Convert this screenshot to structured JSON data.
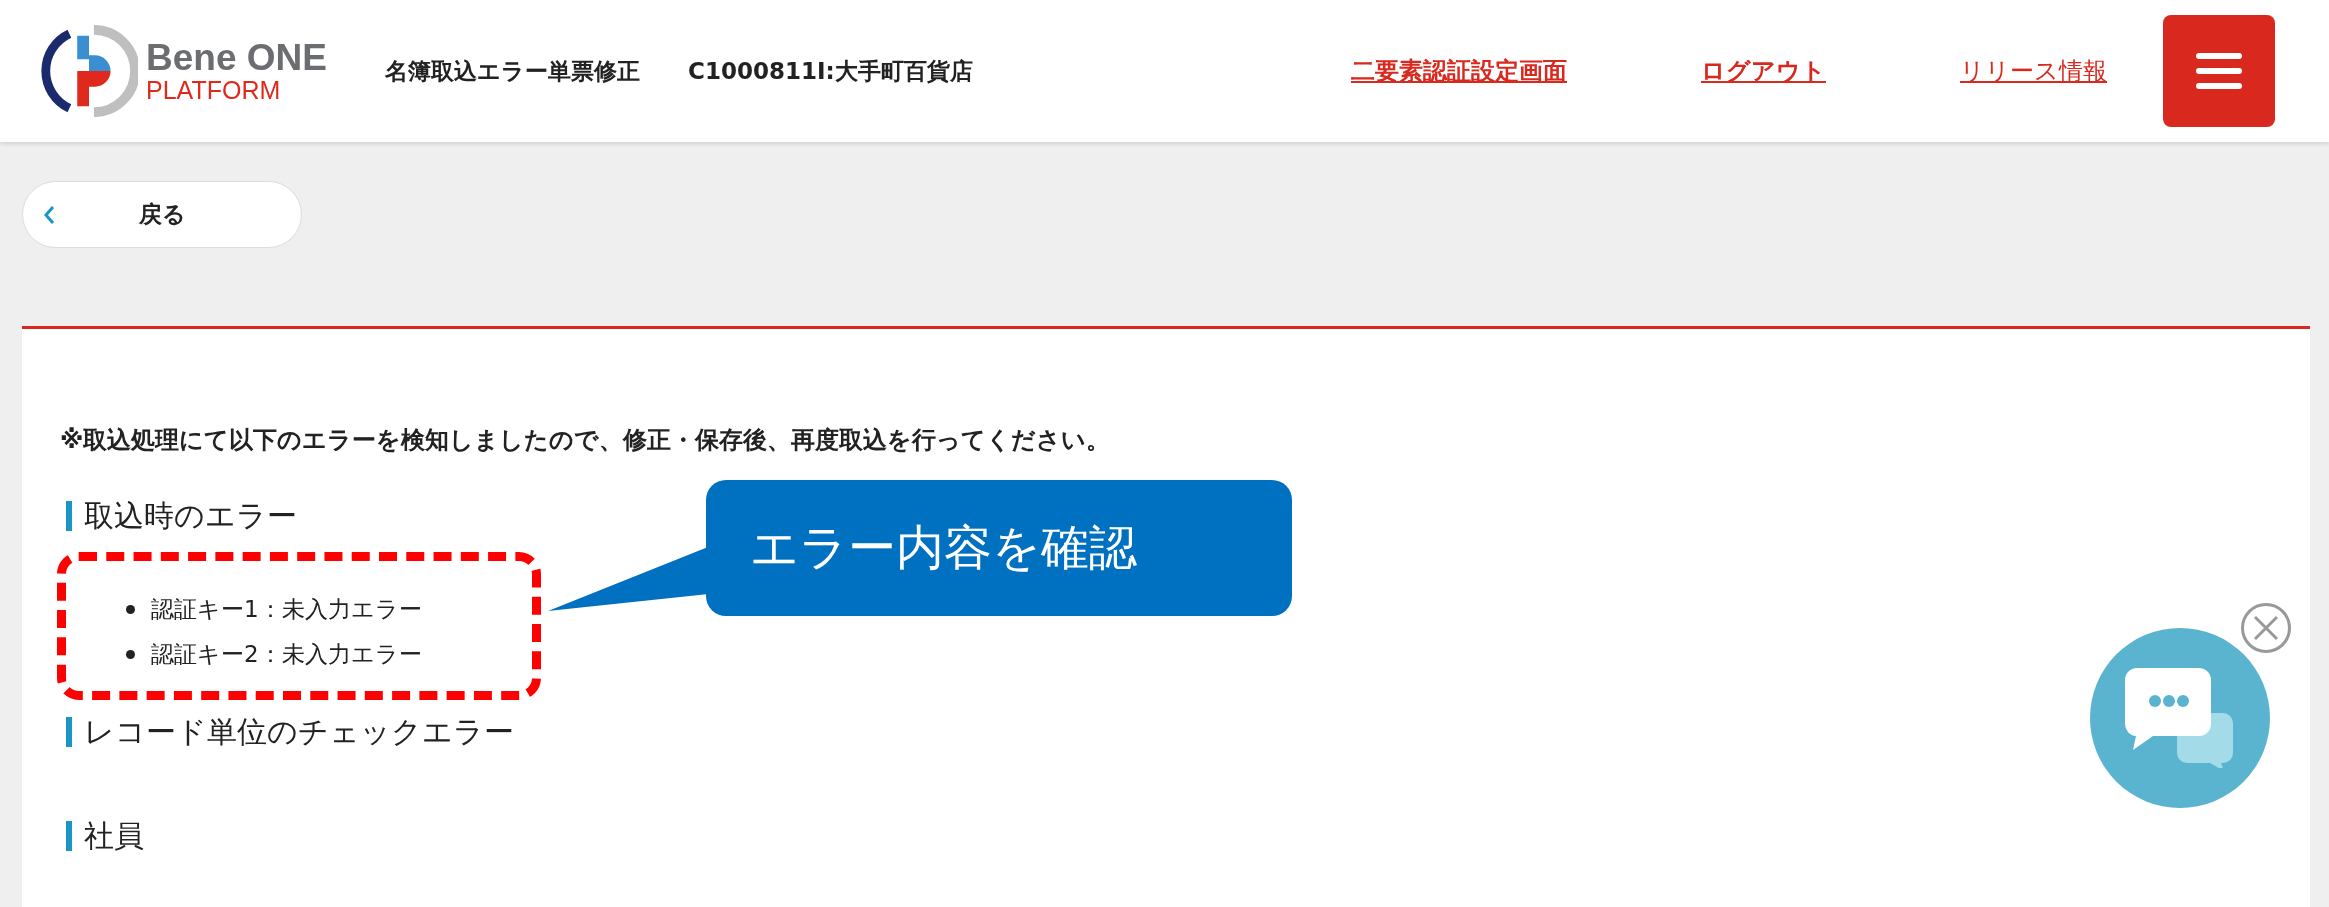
{
  "header": {
    "logo": {
      "name": "Bene ONE",
      "sub": "PLATFORM"
    },
    "page_title": "名簿取込エラー単票修正",
    "company": "C1000811I:大手町百貨店",
    "links": [
      {
        "label": "二要素認証設定画面",
        "bold": true
      },
      {
        "label": "ログアウト",
        "bold": true
      },
      {
        "label": "リリース情報",
        "bold": false
      }
    ]
  },
  "back_button": {
    "label": "戻る"
  },
  "notice": "※取込処理にて以下のエラーを検知しましたので、修正・保存後、再度取込を行ってください。",
  "sections": [
    {
      "title": "取込時のエラー",
      "errors": [
        "認証キー1：未入力エラー",
        "認証キー2：未入力エラー"
      ]
    },
    {
      "title": "レコード単位のチェックエラー"
    },
    {
      "title": "社員"
    }
  ],
  "annotation": {
    "text": "エラー内容を確認"
  }
}
